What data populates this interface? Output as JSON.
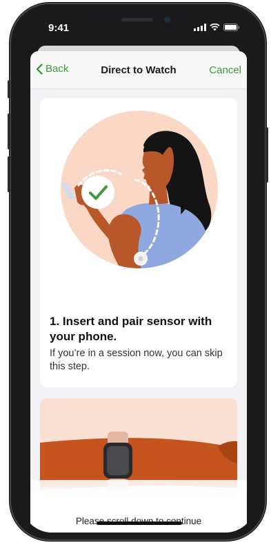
{
  "status_bar": {
    "time": "9:41"
  },
  "nav": {
    "back_label": "Back",
    "title": "Direct to Watch",
    "cancel_label": "Cancel"
  },
  "steps": [
    {
      "title": "1. Insert and pair sensor with your phone.",
      "body": "If you’re in a session now, you can skip this step."
    }
  ],
  "footer": {
    "scroll_hint": "Please scroll down to continue"
  },
  "icons": [
    "back-chevron-icon",
    "checkmark-icon",
    "signal-icon",
    "wifi-icon",
    "battery-icon"
  ],
  "colors": {
    "accent": "#3e9b37",
    "illustration_bg": "#fbd7c6",
    "skin": "#b8572a",
    "shirt": "#8fa8df"
  }
}
